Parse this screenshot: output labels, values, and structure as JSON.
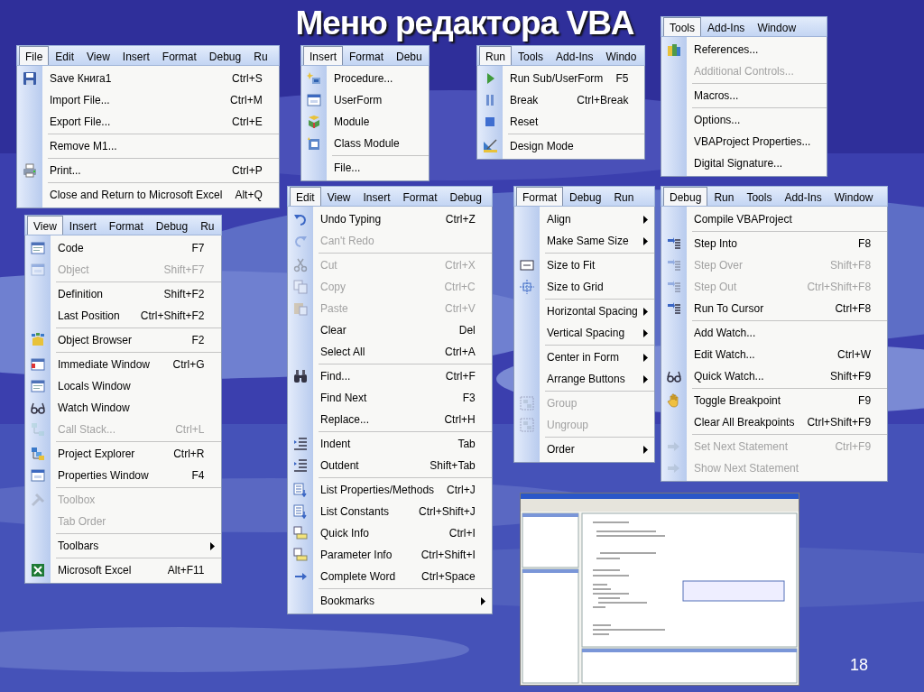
{
  "slide": {
    "title": "Меню редактора VBA",
    "page_number": "18"
  },
  "menus": [
    {
      "menubar": [
        {
          "label": "File",
          "selected": true
        },
        {
          "label": "Edit",
          "selected": false
        },
        {
          "label": "View",
          "selected": false
        },
        {
          "label": "Insert",
          "selected": false
        },
        {
          "label": "Format",
          "selected": false
        },
        {
          "label": "Debug",
          "selected": false
        },
        {
          "label": "Ru",
          "selected": false
        }
      ],
      "items": [
        {
          "kind": "command",
          "label": "Save Книга1",
          "shortcut": "Ctrl+S",
          "disabled": false
        },
        {
          "kind": "command",
          "label": "Import File...",
          "shortcut": "Ctrl+M",
          "disabled": false
        },
        {
          "kind": "command",
          "label": "Export File...",
          "shortcut": "Ctrl+E",
          "disabled": false
        },
        {
          "kind": "separator"
        },
        {
          "kind": "command",
          "label": "Remove M1...",
          "disabled": false
        },
        {
          "kind": "separator"
        },
        {
          "kind": "command",
          "label": "Print...",
          "shortcut": "Ctrl+P",
          "disabled": false
        },
        {
          "kind": "separator"
        },
        {
          "kind": "command",
          "label": "Close and Return to Microsoft Excel",
          "shortcut": "Alt+Q",
          "disabled": false
        }
      ]
    },
    {
      "menubar": [
        {
          "label": "Insert",
          "selected": true
        },
        {
          "label": "Format",
          "selected": false
        },
        {
          "label": "Debu",
          "selected": false
        }
      ],
      "items": [
        {
          "kind": "command",
          "label": "Procedure...",
          "disabled": false
        },
        {
          "kind": "command",
          "label": "UserForm",
          "disabled": false
        },
        {
          "kind": "command",
          "label": "Module",
          "disabled": false
        },
        {
          "kind": "command",
          "label": "Class Module",
          "disabled": false
        },
        {
          "kind": "separator"
        },
        {
          "kind": "command",
          "label": "File...",
          "disabled": false
        }
      ]
    },
    {
      "menubar": [
        {
          "label": "Run",
          "selected": true
        },
        {
          "label": "Tools",
          "selected": false
        },
        {
          "label": "Add-Ins",
          "selected": false
        },
        {
          "label": "Windo",
          "selected": false
        }
      ],
      "items": [
        {
          "kind": "command",
          "label": "Run Sub/UserForm",
          "shortcut": "F5",
          "disabled": false
        },
        {
          "kind": "command",
          "label": "Break",
          "shortcut": "Ctrl+Break",
          "disabled": false
        },
        {
          "kind": "command",
          "label": "Reset",
          "disabled": false
        },
        {
          "kind": "separator"
        },
        {
          "kind": "command",
          "label": "Design Mode",
          "disabled": false
        }
      ]
    },
    {
      "menubar": [
        {
          "label": "Tools",
          "selected": true
        },
        {
          "label": "Add-Ins",
          "selected": false
        },
        {
          "label": "Window",
          "selected": false
        }
      ],
      "items": [
        {
          "kind": "command",
          "label": "References...",
          "disabled": false
        },
        {
          "kind": "command",
          "label": "Additional Controls...",
          "disabled": true
        },
        {
          "kind": "separator"
        },
        {
          "kind": "command",
          "label": "Macros...",
          "disabled": false
        },
        {
          "kind": "separator"
        },
        {
          "kind": "command",
          "label": "Options...",
          "disabled": false
        },
        {
          "kind": "command",
          "label": "VBAProject Properties...",
          "disabled": false
        },
        {
          "kind": "command",
          "label": "Digital Signature...",
          "disabled": false
        }
      ]
    },
    {
      "menubar": [
        {
          "label": "View",
          "selected": true
        },
        {
          "label": "Insert",
          "selected": false
        },
        {
          "label": "Format",
          "selected": false
        },
        {
          "label": "Debug",
          "selected": false
        },
        {
          "label": "Ru",
          "selected": false
        }
      ],
      "items": [
        {
          "kind": "command",
          "label": "Code",
          "shortcut": "F7",
          "disabled": false
        },
        {
          "kind": "command",
          "label": "Object",
          "shortcut": "Shift+F7",
          "disabled": true
        },
        {
          "kind": "separator"
        },
        {
          "kind": "command",
          "label": "Definition",
          "shortcut": "Shift+F2",
          "disabled": false
        },
        {
          "kind": "command",
          "label": "Last Position",
          "shortcut": "Ctrl+Shift+F2",
          "disabled": false
        },
        {
          "kind": "separator"
        },
        {
          "kind": "command",
          "label": "Object Browser",
          "shortcut": "F2",
          "disabled": false
        },
        {
          "kind": "separator"
        },
        {
          "kind": "command",
          "label": "Immediate Window",
          "shortcut": "Ctrl+G",
          "disabled": false
        },
        {
          "kind": "command",
          "label": "Locals Window",
          "disabled": false
        },
        {
          "kind": "command",
          "label": "Watch Window",
          "disabled": false
        },
        {
          "kind": "command",
          "label": "Call Stack...",
          "shortcut": "Ctrl+L",
          "disabled": true
        },
        {
          "kind": "separator"
        },
        {
          "kind": "command",
          "label": "Project Explorer",
          "shortcut": "Ctrl+R",
          "disabled": false
        },
        {
          "kind": "command",
          "label": "Properties Window",
          "shortcut": "F4",
          "disabled": false
        },
        {
          "kind": "separator"
        },
        {
          "kind": "command",
          "label": "Toolbox",
          "disabled": true
        },
        {
          "kind": "command",
          "label": "Tab Order",
          "disabled": true
        },
        {
          "kind": "separator"
        },
        {
          "kind": "submenu",
          "label": "Toolbars",
          "disabled": false
        },
        {
          "kind": "separator"
        },
        {
          "kind": "command",
          "label": "Microsoft Excel",
          "shortcut": "Alt+F11",
          "disabled": false
        }
      ]
    },
    {
      "menubar": [
        {
          "label": "Edit",
          "selected": true
        },
        {
          "label": "View",
          "selected": false
        },
        {
          "label": "Insert",
          "selected": false
        },
        {
          "label": "Format",
          "selected": false
        },
        {
          "label": "Debug",
          "selected": false
        }
      ],
      "items": [
        {
          "kind": "command",
          "label": "Undo Typing",
          "shortcut": "Ctrl+Z",
          "disabled": false
        },
        {
          "kind": "command",
          "label": "Can't Redo",
          "disabled": true
        },
        {
          "kind": "separator"
        },
        {
          "kind": "command",
          "label": "Cut",
          "shortcut": "Ctrl+X",
          "disabled": true
        },
        {
          "kind": "command",
          "label": "Copy",
          "shortcut": "Ctrl+C",
          "disabled": true
        },
        {
          "kind": "command",
          "label": "Paste",
          "shortcut": "Ctrl+V",
          "disabled": true
        },
        {
          "kind": "command",
          "label": "Clear",
          "shortcut": "Del",
          "disabled": false
        },
        {
          "kind": "command",
          "label": "Select All",
          "shortcut": "Ctrl+A",
          "disabled": false
        },
        {
          "kind": "separator"
        },
        {
          "kind": "command",
          "label": "Find...",
          "shortcut": "Ctrl+F",
          "disabled": false
        },
        {
          "kind": "command",
          "label": "Find Next",
          "shortcut": "F3",
          "disabled": false
        },
        {
          "kind": "command",
          "label": "Replace...",
          "shortcut": "Ctrl+H",
          "disabled": false
        },
        {
          "kind": "separator"
        },
        {
          "kind": "command",
          "label": "Indent",
          "shortcut": "Tab",
          "disabled": false
        },
        {
          "kind": "command",
          "label": "Outdent",
          "shortcut": "Shift+Tab",
          "disabled": false
        },
        {
          "kind": "separator"
        },
        {
          "kind": "command",
          "label": "List Properties/Methods",
          "shortcut": "Ctrl+J",
          "disabled": false
        },
        {
          "kind": "command",
          "label": "List Constants",
          "shortcut": "Ctrl+Shift+J",
          "disabled": false
        },
        {
          "kind": "command",
          "label": "Quick Info",
          "shortcut": "Ctrl+I",
          "disabled": false
        },
        {
          "kind": "command",
          "label": "Parameter Info",
          "shortcut": "Ctrl+Shift+I",
          "disabled": false
        },
        {
          "kind": "command",
          "label": "Complete Word",
          "shortcut": "Ctrl+Space",
          "disabled": false
        },
        {
          "kind": "separator"
        },
        {
          "kind": "submenu",
          "label": "Bookmarks",
          "disabled": false
        }
      ]
    },
    {
      "menubar": [
        {
          "label": "Format",
          "selected": true
        },
        {
          "label": "Debug",
          "selected": false
        },
        {
          "label": "Run",
          "selected": false
        }
      ],
      "items": [
        {
          "kind": "submenu",
          "label": "Align",
          "disabled": false
        },
        {
          "kind": "submenu",
          "label": "Make Same Size",
          "disabled": false
        },
        {
          "kind": "separator"
        },
        {
          "kind": "command",
          "label": "Size to Fit",
          "disabled": false
        },
        {
          "kind": "command",
          "label": "Size to Grid",
          "disabled": false
        },
        {
          "kind": "separator"
        },
        {
          "kind": "submenu",
          "label": "Horizontal Spacing",
          "disabled": false
        },
        {
          "kind": "submenu",
          "label": "Vertical Spacing",
          "disabled": false
        },
        {
          "kind": "separator"
        },
        {
          "kind": "submenu",
          "label": "Center in Form",
          "disabled": false
        },
        {
          "kind": "submenu",
          "label": "Arrange Buttons",
          "disabled": false
        },
        {
          "kind": "separator"
        },
        {
          "kind": "command",
          "label": "Group",
          "disabled": true
        },
        {
          "kind": "command",
          "label": "Ungroup",
          "disabled": true
        },
        {
          "kind": "separator"
        },
        {
          "kind": "submenu",
          "label": "Order",
          "disabled": false
        }
      ]
    },
    {
      "menubar": [
        {
          "label": "Debug",
          "selected": true
        },
        {
          "label": "Run",
          "selected": false
        },
        {
          "label": "Tools",
          "selected": false
        },
        {
          "label": "Add-Ins",
          "selected": false
        },
        {
          "label": "Window",
          "selected": false
        }
      ],
      "items": [
        {
          "kind": "command",
          "label": "Compile VBAProject",
          "disabled": false
        },
        {
          "kind": "separator"
        },
        {
          "kind": "command",
          "label": "Step Into",
          "shortcut": "F8",
          "disabled": false
        },
        {
          "kind": "command",
          "label": "Step Over",
          "shortcut": "Shift+F8",
          "disabled": true
        },
        {
          "kind": "command",
          "label": "Step Out",
          "shortcut": "Ctrl+Shift+F8",
          "disabled": true
        },
        {
          "kind": "command",
          "label": "Run To Cursor",
          "shortcut": "Ctrl+F8",
          "disabled": false
        },
        {
          "kind": "separator"
        },
        {
          "kind": "command",
          "label": "Add Watch...",
          "disabled": false
        },
        {
          "kind": "command",
          "label": "Edit Watch...",
          "shortcut": "Ctrl+W",
          "disabled": false
        },
        {
          "kind": "command",
          "label": "Quick Watch...",
          "shortcut": "Shift+F9",
          "disabled": false
        },
        {
          "kind": "separator"
        },
        {
          "kind": "command",
          "label": "Toggle Breakpoint",
          "shortcut": "F9",
          "disabled": false
        },
        {
          "kind": "command",
          "label": "Clear All Breakpoints",
          "shortcut": "Ctrl+Shift+F9",
          "disabled": false
        },
        {
          "kind": "separator"
        },
        {
          "kind": "command",
          "label": "Set Next Statement",
          "shortcut": "Ctrl+F9",
          "disabled": true
        },
        {
          "kind": "command",
          "label": "Show Next Statement",
          "disabled": true
        }
      ]
    }
  ]
}
